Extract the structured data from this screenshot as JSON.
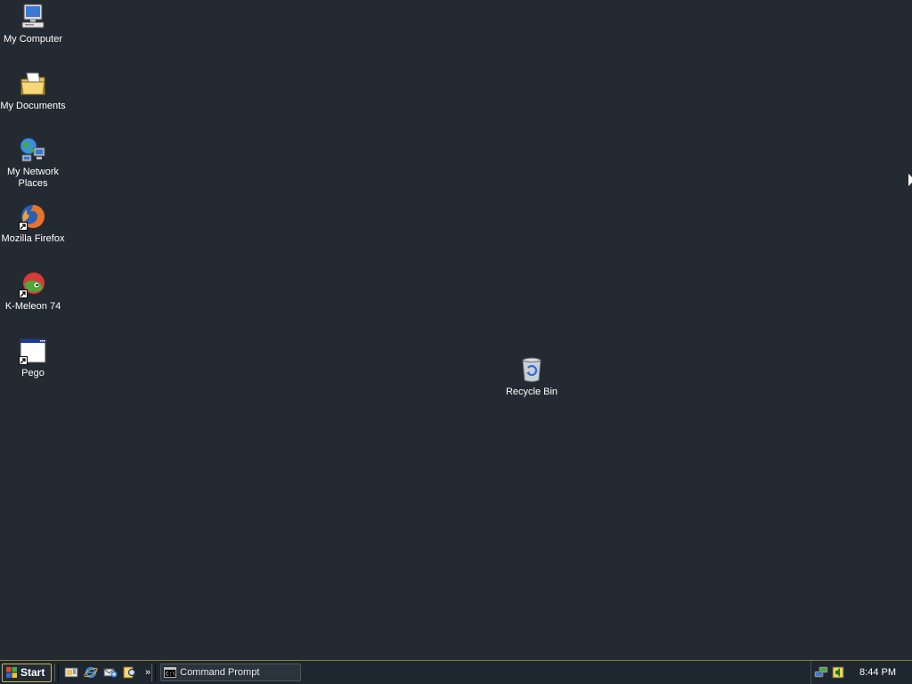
{
  "desktop": {
    "icons": [
      {
        "label": "My Computer",
        "icon": "my-computer-icon"
      },
      {
        "label": "My Documents",
        "icon": "my-documents-icon"
      },
      {
        "label": "My Network Places",
        "icon": "my-network-places-icon"
      },
      {
        "label": "Mozilla Firefox",
        "icon": "firefox-icon",
        "shortcut": true
      },
      {
        "label": "K-Meleon 74",
        "icon": "k-meleon-icon",
        "shortcut": true
      },
      {
        "label": "Pego",
        "icon": "application-window-icon",
        "shortcut": true
      }
    ],
    "recycle_bin": {
      "label": "Recycle Bin",
      "icon": "recycle-bin-icon"
    },
    "background_color": "#232a32"
  },
  "taskbar": {
    "start_label": "Start",
    "quick_launch": [
      {
        "icon": "show-desktop-icon"
      },
      {
        "icon": "internet-explorer-icon"
      },
      {
        "icon": "outlook-express-icon"
      },
      {
        "icon": "search-icon"
      }
    ],
    "overflow_label": "»",
    "tasks": [
      {
        "label": "Command Prompt",
        "icon": "command-prompt-icon"
      }
    ],
    "tray": {
      "icons": [
        {
          "icon": "network-connection-icon"
        },
        {
          "icon": "volume-icon"
        }
      ],
      "clock": "8:44 PM"
    },
    "accent_color": "#c9b25a"
  }
}
